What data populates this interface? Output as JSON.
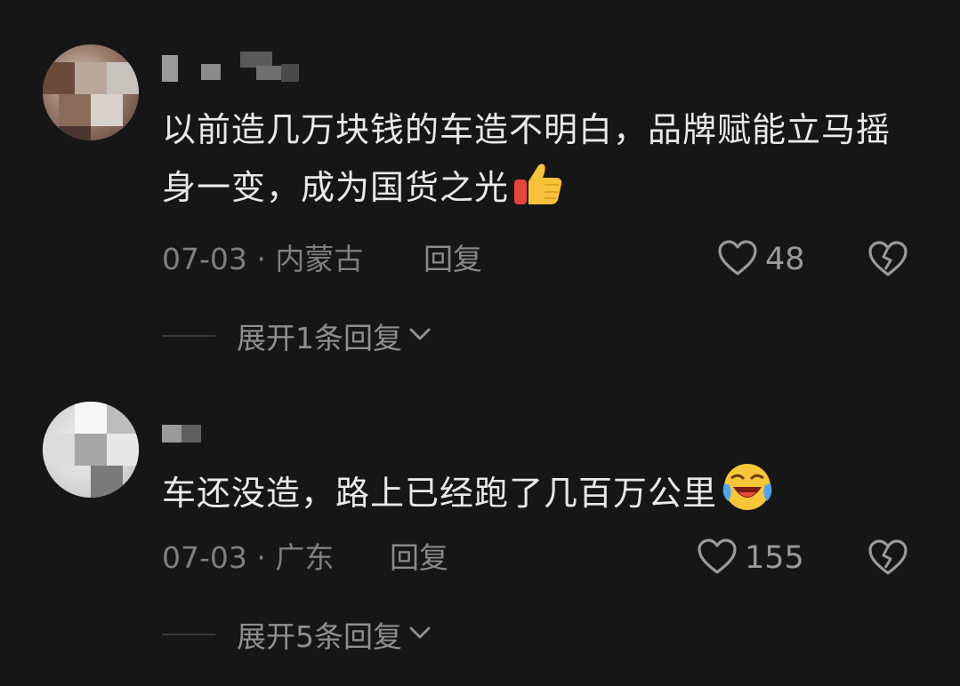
{
  "comments": [
    {
      "text": "以前造几万块钱的车造不明白，品牌赋能立马摇身一变，成为国货之光",
      "emoji": "thumbs-up",
      "date": "07-03",
      "location": "内蒙古",
      "reply_label": "回复",
      "likes": "48",
      "expand_label": "展开1条回复"
    },
    {
      "text": "车还没造，路上已经跑了几百万公里",
      "emoji": "laughing-crying",
      "date": "07-03",
      "location": "广东",
      "reply_label": "回复",
      "likes": "155",
      "expand_label": "展开5条回复"
    }
  ],
  "separator": " · ",
  "icons": {
    "like": "heart-outline-icon",
    "dislike": "broken-heart-icon",
    "expand": "chevron-down-icon"
  },
  "colors": {
    "background": "#161616",
    "text": "#e9e9e9",
    "muted": "#7f7f7f"
  }
}
